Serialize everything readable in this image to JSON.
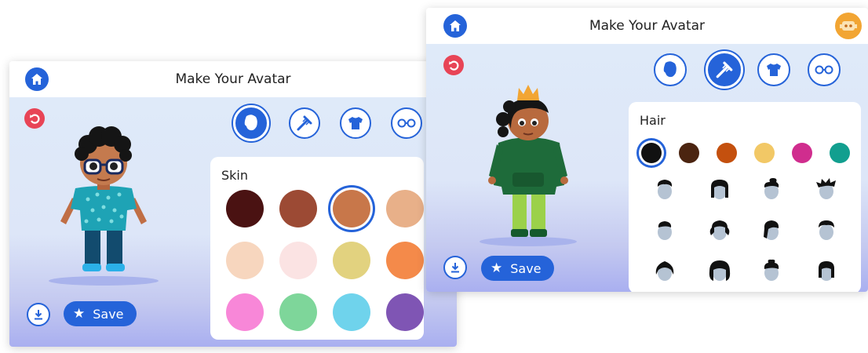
{
  "left_panel": {
    "title": "Make Your Avatar",
    "save_label": "Save",
    "skin_section": {
      "title": "Skin",
      "colors": [
        "#4a1212",
        "#9c4a34",
        "#c8774a",
        "#e8b089",
        "#f7d6be",
        "#fbe3e3",
        "#e2d27f",
        "#f48a4a",
        "#f887d8",
        "#7ed69a",
        "#6fd3ec",
        "#7f55b4"
      ],
      "selected_index": 2
    },
    "categories": [
      {
        "name": "face",
        "selected": true
      },
      {
        "name": "hair",
        "selected": false
      },
      {
        "name": "clothes",
        "selected": false
      },
      {
        "name": "glasses",
        "selected": false
      }
    ]
  },
  "right_panel": {
    "title": "Make Your Avatar",
    "save_label": "Save",
    "hair_section": {
      "title": "Hair",
      "colors": [
        "#111111",
        "#4b2410",
        "#c4500e",
        "#f2c866",
        "#d02d8e",
        "#129f8f"
      ],
      "selected_index": 0,
      "style_count": 12
    },
    "categories": [
      {
        "name": "face",
        "selected": false
      },
      {
        "name": "hair",
        "selected": true
      },
      {
        "name": "clothes",
        "selected": false
      },
      {
        "name": "glasses",
        "selected": false
      }
    ]
  }
}
